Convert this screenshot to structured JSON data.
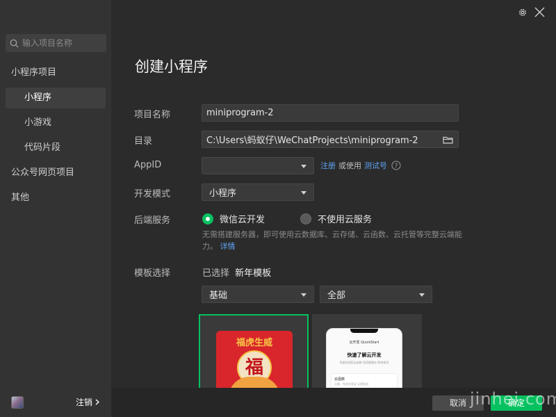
{
  "sidebar": {
    "search_placeholder": "输入项目名称",
    "items": [
      {
        "label": "小程序项目"
      },
      {
        "label": "小程序"
      },
      {
        "label": "小游戏"
      },
      {
        "label": "代码片段"
      },
      {
        "label": "公众号网页项目"
      },
      {
        "label": "其他"
      }
    ],
    "logout_label": "注销"
  },
  "top_icons": [
    "gear-icon",
    "close-icon"
  ],
  "main": {
    "title": "创建小程序",
    "project_name": {
      "label": "项目名称",
      "value": "miniprogram-2"
    },
    "directory": {
      "label": "目录",
      "value": "C:\\Users\\蚂蚁仔\\WeChatProjects\\miniprogram-2"
    },
    "appid": {
      "label": "AppID",
      "value": "",
      "register_link": "注册",
      "or_text": "或使用",
      "test_link": "测试号"
    },
    "dev_mode": {
      "label": "开发模式",
      "value": "小程序"
    },
    "backend": {
      "label": "后端服务",
      "option_cloud": "微信云开发",
      "option_none": "不使用云服务",
      "hint": "无需搭建服务器，即可使用云数据库、云存储、云函数、云托管等完整云端能力。",
      "hint_link": "详情"
    },
    "template": {
      "label": "模板选择",
      "selected_prefix": "已选择",
      "selected_name": "新年模板",
      "filter_category": "基础",
      "filter_scope": "全部"
    }
  },
  "preview_text": {
    "poster_banner": "福虎生威",
    "poster_char": "福",
    "phone_header": "云开发 QuickStart",
    "phone_title": "快速了解云开发",
    "phone_subtitle": "免鉴权调用云函数 免搭建服务 简单易用",
    "phone_section": "云函数",
    "phone_section_desc": "无需，免域名登录 无需鉴权"
  },
  "footer": {
    "cancel_label": "取消",
    "confirm_label": "确定"
  },
  "watermark": "jinhei.com",
  "colors": {
    "accent": "#07c160",
    "link": "#5ea3f5",
    "sidebar_bg": "#333333",
    "main_bg": "#2b2b2b"
  }
}
